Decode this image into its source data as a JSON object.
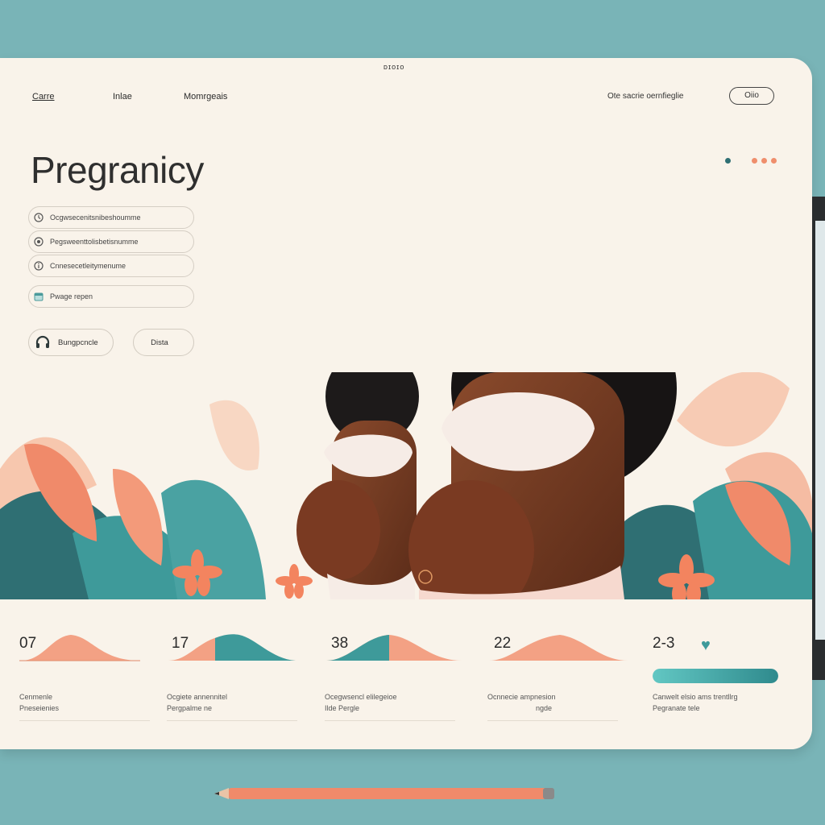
{
  "window": {
    "top_label": "ᴅɪᴏɪᴏ"
  },
  "nav": [
    {
      "label": "Carre"
    },
    {
      "label": "Inlae"
    },
    {
      "label": "Momrgeais"
    }
  ],
  "header": {
    "text": "Ote sacrie oernfieglie",
    "button_label": "Oiio"
  },
  "page_title": "Pregranicy",
  "menu_items": [
    {
      "label": "Ocgwsecenitsnibeshoumme",
      "icon": "clock-icon"
    },
    {
      "label": "Pegsweenttolisbetisnumme",
      "icon": "settings-icon"
    },
    {
      "label": "Cnnesecetleitymenume",
      "icon": "info-icon"
    },
    {
      "label": "Pwage repen",
      "icon": "calendar-icon"
    }
  ],
  "actions": {
    "primary_label": "Bungpcncle",
    "secondary_label": "Dista"
  },
  "colors": {
    "accent_coral": "#f08a6a",
    "accent_teal": "#3e9a9a",
    "background": "#79b4b7",
    "card": "#f9f3ea"
  },
  "stats": [
    {
      "value": "07",
      "line1": "Cenmenle",
      "line2": "Pneseienies",
      "chart": "coral-bell"
    },
    {
      "value": "17",
      "line1": "Ocgiete annennitel",
      "line2": "Pergpalme    ne",
      "chart": "teal-coral-bell"
    },
    {
      "value": "38",
      "line1": "Ocegwsencl elilegeioe",
      "line2": "Ilde          Pergle",
      "chart": "teal-coral-bell-2"
    },
    {
      "value": "22",
      "line1": "Ocnnecie ampnesion",
      "line2": "ngde",
      "chart": "coral-bell-2"
    },
    {
      "value": "2-3",
      "line1": "Canwelt elsio ams trentllrg",
      "line2": "Pegranate   tele",
      "chart": "progress",
      "progress": 1.0
    }
  ]
}
